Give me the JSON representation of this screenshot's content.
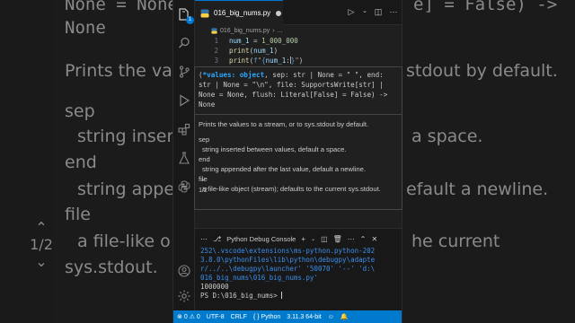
{
  "background": {
    "line_top_left": "None = None",
    "line_top_right": "e] = False) ->",
    "line_none": "None",
    "line_prints_left": "Prints the val",
    "line_prints_right": "stdout by default.",
    "line_sep": "sep",
    "line_insert_left": "string insert",
    "line_insert_right": "a space.",
    "line_end": "end",
    "line_append_left": "string appe",
    "line_append_right": "efault a newline.",
    "line_file": "file",
    "line_filelike_left": "a file-like o",
    "line_filelike_right": "he current",
    "line_sysstdout": "sys.stdout.",
    "pager": "1/2"
  },
  "tab": {
    "filename": "016_big_nums.py"
  },
  "breadcrumb": {
    "file": "016_big_nums.py",
    "more": "..."
  },
  "activity": {
    "explorer_badge": "1"
  },
  "editor": {
    "lines": [
      {
        "num": "1",
        "name": "num_1",
        "op": " = ",
        "value": "1_000_000"
      },
      {
        "num": "2",
        "fn": "print",
        "open": "(",
        "arg": "num_1",
        "close": ")"
      },
      {
        "num": "3",
        "fn": "print",
        "open": "(",
        "fprefix": "f",
        "q1": "\"",
        "brace_open": "{",
        "arg": "num_1",
        "colon": ":",
        "brace_close": "}",
        "q2": "\"",
        "close": ")"
      }
    ]
  },
  "signature": {
    "pre": "(",
    "param_active": "*values: object",
    "rest": ", sep: str | None = \" \", end: str | None = \"\\n\", file: SupportsWrite[str] | None = None, flush: Literal[False] = False) -> None",
    "doc_intro": "Prints the values to a stream, or to sys.stdout by default.",
    "param_sep": "sep",
    "param_sep_desc": "string inserted between values, default a space.",
    "param_end": "end",
    "param_end_desc": "string appended after the last value, default a newline.",
    "param_file": "file",
    "param_file_desc": "a file-like object (stream); defaults to the current sys.stdout.",
    "pager": "1/2"
  },
  "panel": {
    "console_label": "Python Debug Console",
    "terminal_lines": [
      "252\\.vscode\\extensions\\ms-python.python-202",
      "3.8.0\\pythonFiles\\lib\\python\\debugpy\\adapte",
      "r/../..\\debugpy\\launcher' '50070' '--' 'd:\\",
      "016_big_nums\\016_big_nums.py'",
      "1000000",
      "PS D:\\016_big_nums> "
    ]
  },
  "statusbar": {
    "problems": "0",
    "warnings": "0",
    "encoding": "UTF-8",
    "eol": "CRLF",
    "language": "Python",
    "interpreter": "3.11.3 64-bit"
  }
}
